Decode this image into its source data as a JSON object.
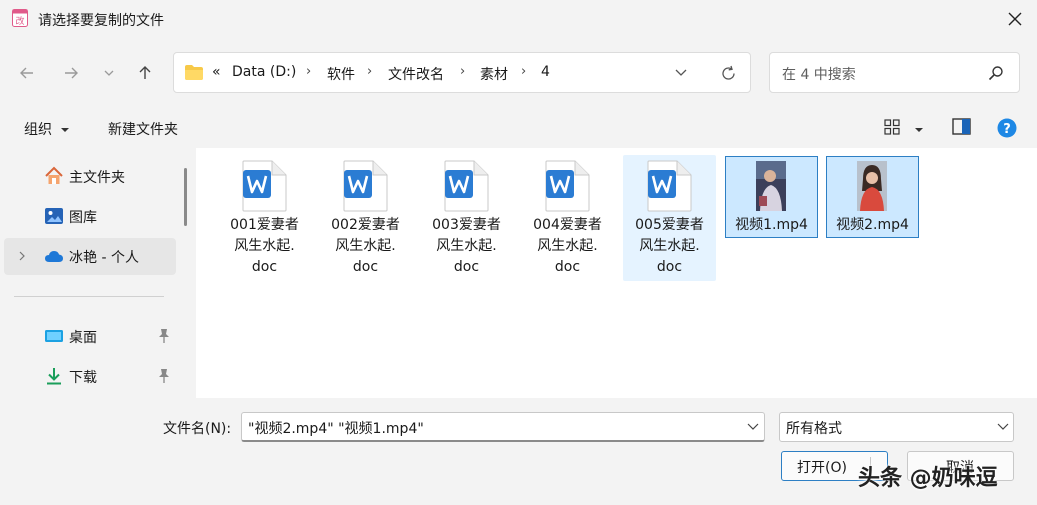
{
  "window": {
    "title": "请选择要复制的文件"
  },
  "nav": {
    "breadcrumb": {
      "overflow": "«",
      "items": [
        "Data (D:)",
        "软件",
        "文件改名",
        "素材",
        "4"
      ]
    },
    "search_placeholder": "在 4 中搜索"
  },
  "toolbar": {
    "organize_label": "组织",
    "new_folder_label": "新建文件夹"
  },
  "sidebar": {
    "items": [
      {
        "label": "主文件夹",
        "icon": "home-icon"
      },
      {
        "label": "图库",
        "icon": "gallery-icon"
      },
      {
        "label": "冰艳 - 个人",
        "icon": "cloud-icon"
      },
      {
        "label": "桌面",
        "icon": "desktop-icon"
      },
      {
        "label": "下载",
        "icon": "download-icon"
      }
    ]
  },
  "files": [
    {
      "name": "001爱妻者风生水起.doc",
      "lines": [
        "001爱妻者",
        "风生水起.",
        "doc"
      ],
      "type": "word-doc"
    },
    {
      "name": "002爱妻者风生水起.doc",
      "lines": [
        "002爱妻者",
        "风生水起.",
        "doc"
      ],
      "type": "word-doc"
    },
    {
      "name": "003爱妻者风生水起.doc",
      "lines": [
        "003爱妻者",
        "风生水起.",
        "doc"
      ],
      "type": "word-doc"
    },
    {
      "name": "004爱妻者风生水起.doc",
      "lines": [
        "004爱妻者",
        "风生水起.",
        "doc"
      ],
      "type": "word-doc"
    },
    {
      "name": "005爱妻者风生水起.doc",
      "lines": [
        "005爱妻者",
        "风生水起.",
        "doc"
      ],
      "type": "word-doc"
    },
    {
      "name": "视频1.mp4",
      "type": "video"
    },
    {
      "name": "视频2.mp4",
      "type": "video"
    }
  ],
  "footer": {
    "filename_label": "文件名(N):",
    "filename_value": "\"视频2.mp4\" \"视频1.mp4\"",
    "filetype_value": "所有格式",
    "open_label": "打开(O)",
    "cancel_label": "取消"
  },
  "watermark": "头条 @奶味逗",
  "colors": {
    "accent": "#0067c0",
    "selection": "#cce8ff",
    "word_blue": "#2b7cd3"
  }
}
